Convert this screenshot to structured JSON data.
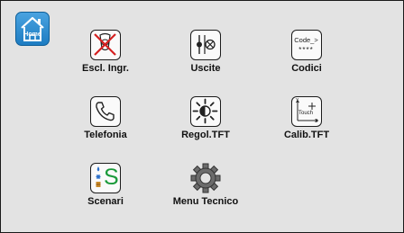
{
  "home": {
    "label": "Home",
    "icon": "home-icon"
  },
  "tiles": [
    {
      "name": "escl-ingr",
      "label": "Escl. Ingr.",
      "icon": "sensor-excluded-icon"
    },
    {
      "name": "uscite",
      "label": "Uscite",
      "icon": "outputs-icon"
    },
    {
      "name": "codici",
      "label": "Codici",
      "icon": "code-icon",
      "code_title": "Code_>",
      "code_mask": "****"
    },
    {
      "name": "telefonia",
      "label": "Telefonia",
      "icon": "phone-icon"
    },
    {
      "name": "regol-tft",
      "label": "Regol.TFT",
      "icon": "brightness-icon"
    },
    {
      "name": "calib-tft",
      "label": "Calib.TFT",
      "icon": "touch-calibration-icon",
      "touch_text": "Touch",
      "axis_y": "Y",
      "axis_x": "X"
    },
    {
      "name": "scenari",
      "label": "Scenari",
      "icon": "scenarios-icon",
      "scenari_glyph": "S"
    },
    {
      "name": "menu-tecnico",
      "label": "Menu Tecnico",
      "icon": "gear-icon"
    }
  ],
  "colors": {
    "background": "#e3e3e3",
    "home_button": "#1d7cc2",
    "scenari_green": "#1a9a3a",
    "excluded_red": "#d42020"
  }
}
